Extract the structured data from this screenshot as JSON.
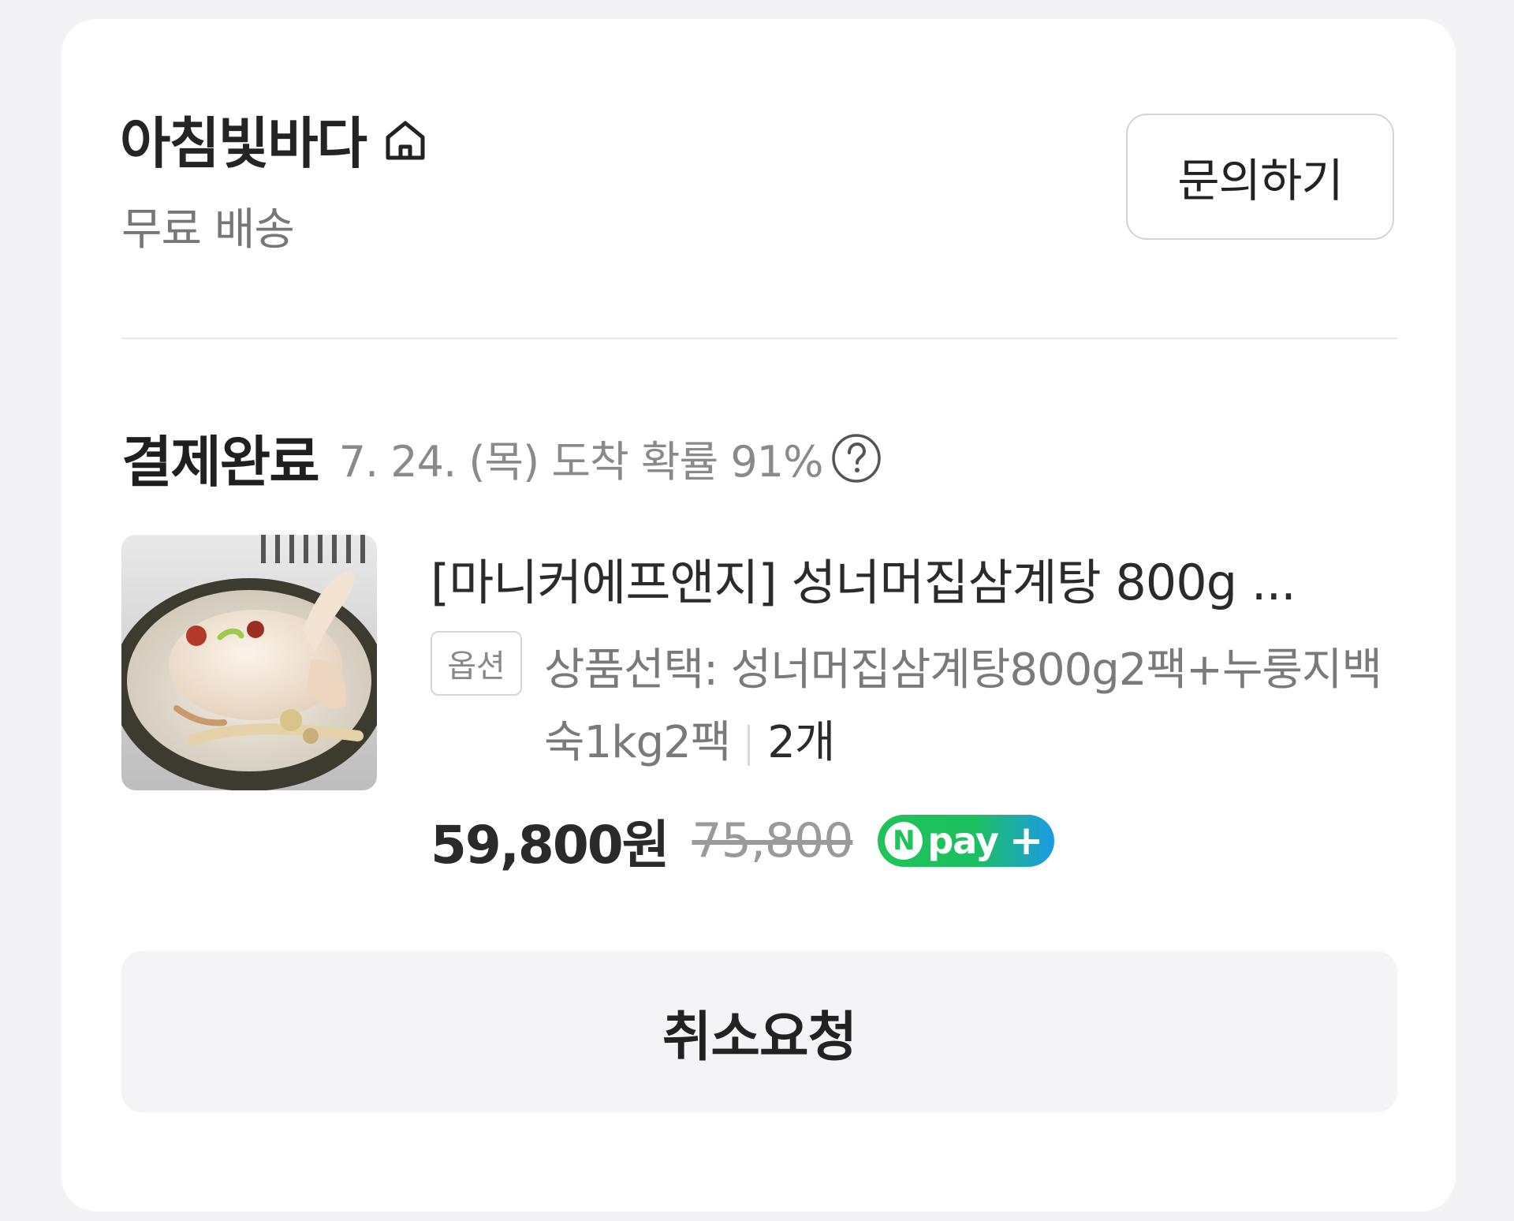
{
  "store": {
    "name": "아침빛바다",
    "home_icon": "home-icon",
    "shipping": "무료 배송",
    "inquiry_label": "문의하기"
  },
  "order": {
    "status": "결제완료",
    "arrival": "7. 24. (목) 도착 확률 91%",
    "help_icon": "question-circle-icon"
  },
  "product": {
    "title": "[마니커에프앤지] 성너머집삼계탕 800g ...",
    "option_badge": "옵션",
    "option_text": "상품선택: 성너머집삼계탕800g2팩+누룽지백숙1kg2팩",
    "quantity": "2개",
    "price": "59,800원",
    "original_price": "75,800",
    "pay_badge": {
      "n": "N",
      "text": "pay",
      "plus": "+",
      "colors": [
        "#1ec45a",
        "#1a9be8"
      ]
    }
  },
  "actions": {
    "cancel_label": "취소요청"
  }
}
